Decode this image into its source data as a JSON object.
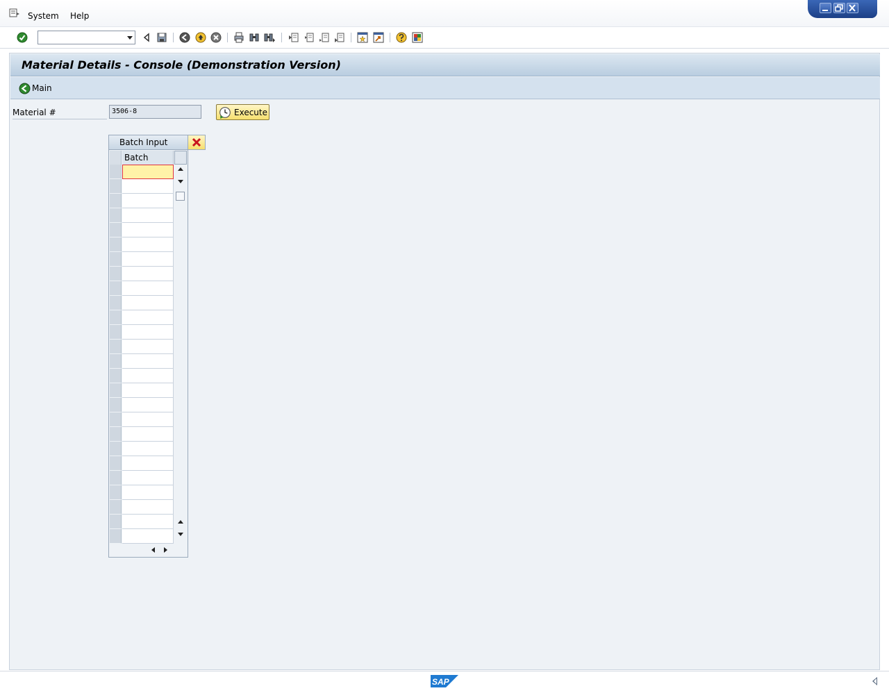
{
  "menubar": {
    "items": [
      {
        "label": "System",
        "accel": "S"
      },
      {
        "label": "Help",
        "accel": "H"
      }
    ]
  },
  "window_controls": {
    "minimize": "_",
    "restore": "▫",
    "close": "×"
  },
  "toolbar": {
    "icons": [
      "enter-icon",
      "command-field",
      "back-arrow-icon",
      "save-icon",
      "back-icon",
      "exit-icon",
      "cancel-icon",
      "print-icon",
      "find-icon",
      "find-next-icon",
      "first-page-icon",
      "previous-page-icon",
      "next-page-icon",
      "last-page-icon",
      "create-session-icon",
      "shortcut-icon",
      "help-icon",
      "customize-layout-icon"
    ],
    "command_field_value": ""
  },
  "header": {
    "title": "Material Details - Console (Demonstration Version)"
  },
  "app_toolbar": {
    "main_label": "Main"
  },
  "form": {
    "material_label": "Material #",
    "material_value": "3506-8",
    "execute_label": "Execute"
  },
  "batch_table": {
    "title": "Batch Input",
    "column": "Batch",
    "rows": [
      "",
      "",
      "",
      "",
      "",
      "",
      "",
      "",
      "",
      "",
      "",
      "",
      "",
      "",
      "",
      "",
      "",
      "",
      "",
      "",
      "",
      "",
      "",
      "",
      "",
      ""
    ]
  },
  "statusbar": {
    "logo": "SAP"
  },
  "colors": {
    "accent": "#d4e1ee",
    "button_yellow": "#f6df6e",
    "active_cell": "#fff2a8",
    "background": "#eef2f6"
  }
}
